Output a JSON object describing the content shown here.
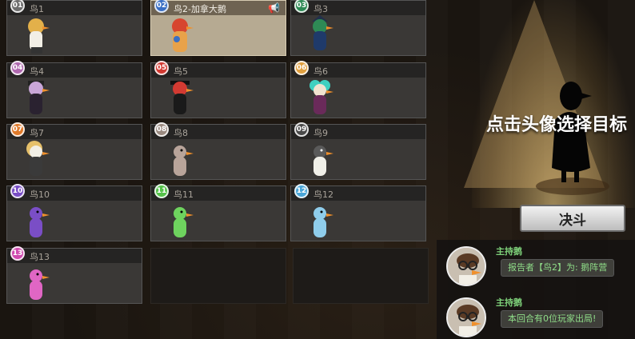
{
  "players": [
    {
      "num": "01",
      "name": "鸟1",
      "color": "#6d6d6d"
    },
    {
      "num": "02",
      "name": "鸟2-加拿大鹅",
      "color": "#3a6fc4"
    },
    {
      "num": "03",
      "name": "鸟3",
      "color": "#2e8a55"
    },
    {
      "num": "04",
      "name": "鸟4",
      "color": "#b06ab0"
    },
    {
      "num": "05",
      "name": "鸟5",
      "color": "#d23a32"
    },
    {
      "num": "06",
      "name": "鸟6",
      "color": "#e0a040"
    },
    {
      "num": "07",
      "name": "鸟7",
      "color": "#e07a2a"
    },
    {
      "num": "08",
      "name": "鸟8",
      "color": "#9a8a80"
    },
    {
      "num": "09",
      "name": "鸟9",
      "color": "#4a4a4a"
    },
    {
      "num": "10",
      "name": "鸟10",
      "color": "#7a4ec6"
    },
    {
      "num": "11",
      "name": "鸟11",
      "color": "#55c24a"
    },
    {
      "num": "12",
      "name": "鸟12",
      "color": "#4aa6d8"
    },
    {
      "num": "13",
      "name": "鸟13",
      "color": "#d04ab0"
    }
  ],
  "right_panel": {
    "prompt": "点击头像选择目标",
    "duel_button": "决斗"
  },
  "chat": [
    {
      "sender": "主持鹅",
      "text": "报告者【鸟2】为: 鹅阵营"
    },
    {
      "sender": "主持鹅",
      "text": "本回合有0位玩家出局!"
    }
  ]
}
